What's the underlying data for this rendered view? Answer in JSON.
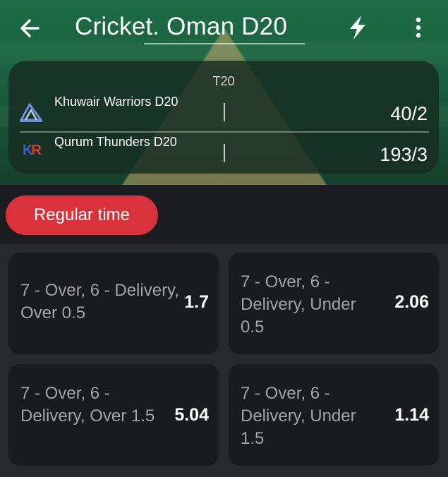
{
  "header": {
    "title": "Cricket. Oman D20",
    "back_icon": "arrow-left-icon",
    "bolt_icon": "lightning-bolt-icon",
    "menu_icon": "more-vertical-icon"
  },
  "match": {
    "format": "T20",
    "teams": [
      {
        "name": "Khuwair Warriors D20",
        "score": "40/2",
        "logo_icon": "triangle-logo-icon"
      },
      {
        "name": "Qurum Thunders D20",
        "score": "193/3",
        "logo_icon": "kr-logo-icon",
        "logo_text": "KR"
      }
    ]
  },
  "tabs": {
    "active": "Regular time"
  },
  "markets": [
    {
      "label": "7 - Over, 6 - Delivery, Over 0.5",
      "odds": "1.7"
    },
    {
      "label": "7 - Over, 6 - Delivery, Under 0.5",
      "odds": "2.06"
    },
    {
      "label": "7 - Over, 6 - Delivery, Over 1.5",
      "odds": "5.04"
    },
    {
      "label": "7 - Over, 6 - Delivery, Under 1.5",
      "odds": "1.14"
    }
  ],
  "colors": {
    "accent": "#d9323a",
    "pitch_green": "#1d6d46",
    "card_bg": "#1a1b1e"
  }
}
